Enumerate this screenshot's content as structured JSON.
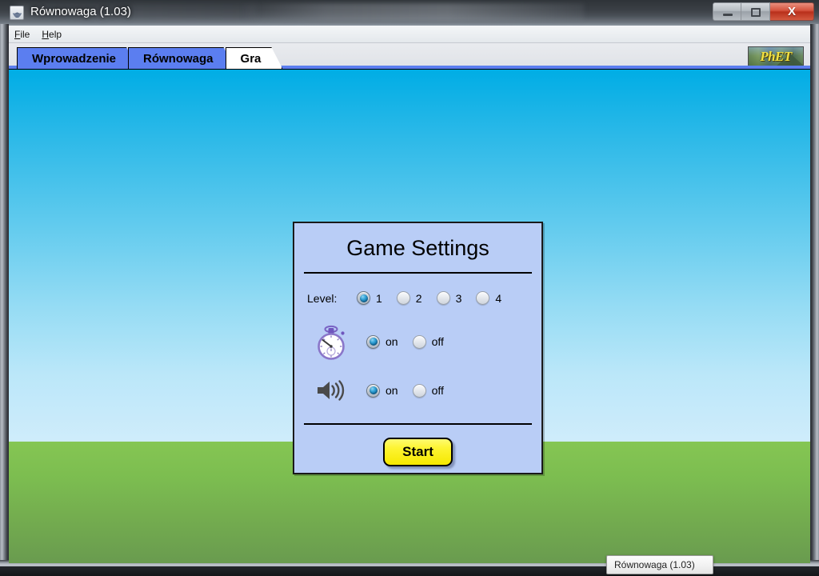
{
  "window": {
    "title": "Równowaga (1.03)",
    "app_icon": "java-cup-icon",
    "controls": {
      "minimize": "minimize-button",
      "maximize": "maximize-button",
      "close_glyph": "X"
    }
  },
  "menubar": {
    "items": [
      {
        "mnemonic": "F",
        "rest": "ile"
      },
      {
        "mnemonic": "H",
        "rest": "elp"
      }
    ]
  },
  "tabs": [
    {
      "label": "Wprowadzenie",
      "active": false
    },
    {
      "label": "Równowaga",
      "active": false
    },
    {
      "label": "Gra",
      "active": true
    }
  ],
  "logo": {
    "text": "PhET"
  },
  "panel": {
    "title": "Game Settings",
    "level": {
      "label": "Level:",
      "options": [
        {
          "label": "1",
          "selected": true
        },
        {
          "label": "2",
          "selected": false
        },
        {
          "label": "3",
          "selected": false
        },
        {
          "label": "4",
          "selected": false
        }
      ]
    },
    "timer": {
      "icon": "stopwatch-icon",
      "options": [
        {
          "label": "on",
          "selected": true
        },
        {
          "label": "off",
          "selected": false
        }
      ]
    },
    "sound": {
      "icon": "speaker-icon",
      "options": [
        {
          "label": "on",
          "selected": true
        },
        {
          "label": "off",
          "selected": false
        }
      ]
    },
    "start_label": "Start"
  },
  "taskbar": {
    "item_label": "Równowaga (1.03)"
  },
  "colors": {
    "sky_top": "#00ADE5",
    "sky_bottom": "#CFECFB",
    "grass": "#7CBD50",
    "panel_bg": "#B9CDF6",
    "tab_active": "#FFFFFF",
    "tab_inactive": "#5B7EF0",
    "start_button": "#FDF432",
    "radio_selected": "#0D6EA6",
    "close_button": "#D4503A"
  }
}
